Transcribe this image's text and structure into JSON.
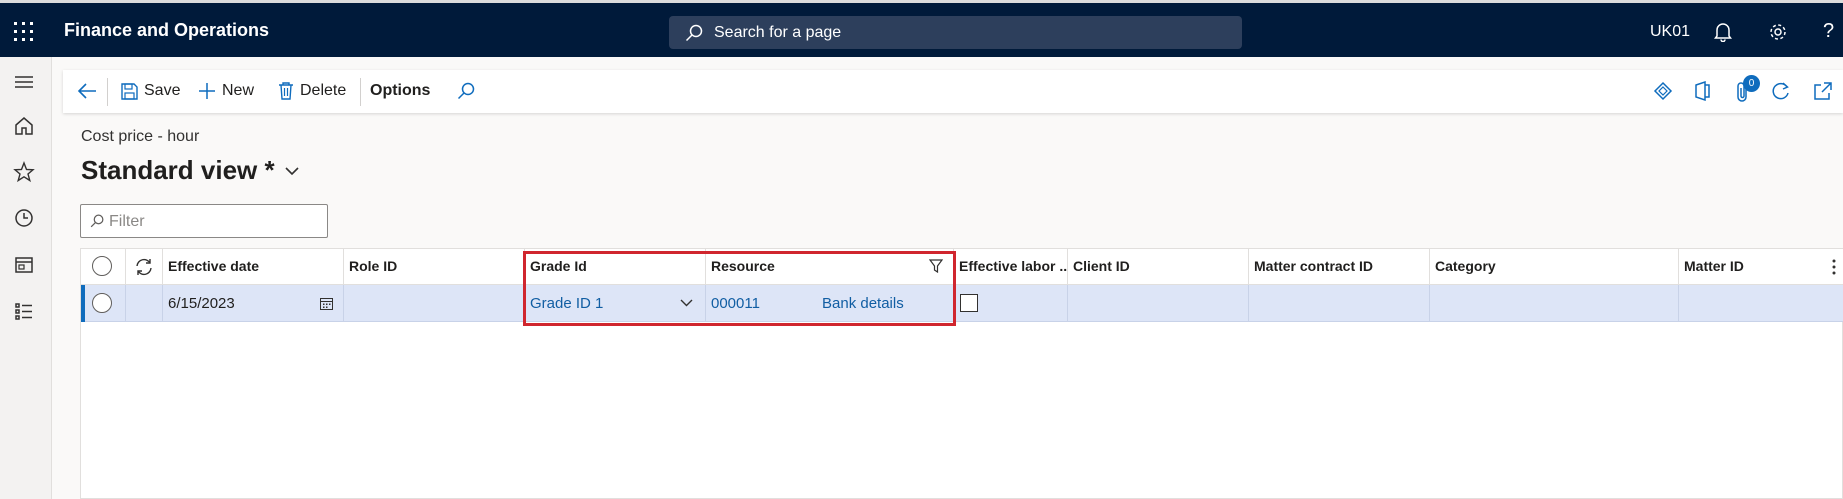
{
  "topbar": {
    "app_title": "Finance and Operations",
    "search_placeholder": "Search for a page",
    "company": "UK01",
    "help": "?"
  },
  "actions": {
    "save": "Save",
    "new": "New",
    "delete": "Delete",
    "options": "Options",
    "badge_count": "0"
  },
  "page": {
    "subtitle": "Cost price - hour",
    "view_title": "Standard view *"
  },
  "filter": {
    "placeholder": "Filter"
  },
  "grid": {
    "columns": {
      "effective_date": "Effective date",
      "role_id": "Role ID",
      "grade_id": "Grade Id",
      "resource": "Resource",
      "effective_labor": "Effective labor ...",
      "client_id": "Client ID",
      "matter_contract_id": "Matter contract ID",
      "category": "Category",
      "matter_id": "Matter ID"
    },
    "row": {
      "effective_date": "6/15/2023",
      "role_id": "",
      "grade_id": "Grade ID 1",
      "resource_id": "000011",
      "resource_name": "Bank details",
      "effective_labor_checked": false,
      "client_id": "",
      "matter_contract_id": "",
      "category": "",
      "matter_id": ""
    }
  },
  "colors": {
    "nav_bg": "#001a3a",
    "selected_row": "#dde5f7",
    "link": "#115ea3",
    "highlight": "#d0262e"
  }
}
